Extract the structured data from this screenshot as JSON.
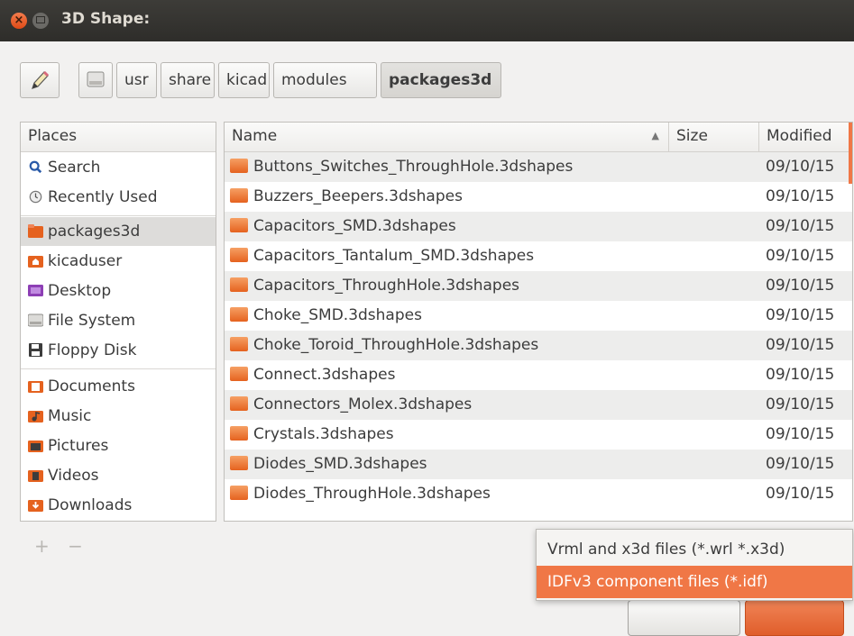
{
  "window": {
    "title": "3D Shape:",
    "close_glyph": "×"
  },
  "pathbar": {
    "segments": [
      "usr",
      "share",
      "kicad",
      "modules",
      "packages3d"
    ],
    "active_segment": "packages3d"
  },
  "places": {
    "header": "Places",
    "items": [
      {
        "label": "Search",
        "icon": "search-icon"
      },
      {
        "label": "Recently Used",
        "icon": "clock-icon"
      },
      {
        "label": "packages3d",
        "icon": "folder-icon",
        "selected": true
      },
      {
        "label": "kicaduser",
        "icon": "home-folder-icon"
      },
      {
        "label": "Desktop",
        "icon": "desktop-icon"
      },
      {
        "label": "File System",
        "icon": "drive-icon"
      },
      {
        "label": "Floppy Disk",
        "icon": "floppy-icon"
      },
      {
        "label": "Documents",
        "icon": "documents-icon"
      },
      {
        "label": "Music",
        "icon": "music-icon"
      },
      {
        "label": "Pictures",
        "icon": "pictures-icon"
      },
      {
        "label": "Videos",
        "icon": "videos-icon"
      },
      {
        "label": "Downloads",
        "icon": "downloads-icon"
      }
    ],
    "add": "+",
    "remove": "−"
  },
  "files": {
    "columns": {
      "name": "Name",
      "size": "Size",
      "modified": "Modified"
    },
    "sort_indicator": "▲",
    "rows": [
      {
        "name": "Buttons_Switches_ThroughHole.3dshapes",
        "modified": "09/10/15"
      },
      {
        "name": "Buzzers_Beepers.3dshapes",
        "modified": "09/10/15"
      },
      {
        "name": "Capacitors_SMD.3dshapes",
        "modified": "09/10/15"
      },
      {
        "name": "Capacitors_Tantalum_SMD.3dshapes",
        "modified": "09/10/15"
      },
      {
        "name": "Capacitors_ThroughHole.3dshapes",
        "modified": "09/10/15"
      },
      {
        "name": "Choke_SMD.3dshapes",
        "modified": "09/10/15"
      },
      {
        "name": "Choke_Toroid_ThroughHole.3dshapes",
        "modified": "09/10/15"
      },
      {
        "name": "Connect.3dshapes",
        "modified": "09/10/15"
      },
      {
        "name": "Connectors_Molex.3dshapes",
        "modified": "09/10/15"
      },
      {
        "name": "Crystals.3dshapes",
        "modified": "09/10/15"
      },
      {
        "name": "Diodes_SMD.3dshapes",
        "modified": "09/10/15"
      },
      {
        "name": "Diodes_ThroughHole.3dshapes",
        "modified": "09/10/15"
      }
    ]
  },
  "filter_popup": {
    "options": [
      "Vrml and x3d files (*.wrl *.x3d)",
      "IDFv3 component files (*.idf)"
    ],
    "highlighted": 1
  },
  "colors": {
    "accent": "#f07746",
    "titlebar": "#3d3c38",
    "folder": "#e5621f"
  }
}
